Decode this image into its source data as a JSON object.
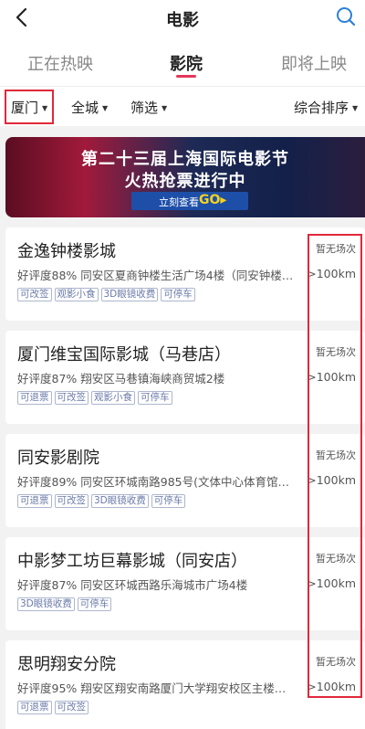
{
  "header": {
    "title": "电影",
    "back_icon": "chevron-left-icon",
    "search_icon": "search-icon"
  },
  "tabs": [
    {
      "label": "正在热映",
      "active": false
    },
    {
      "label": "影院",
      "active": true
    },
    {
      "label": "即将上映",
      "active": false
    }
  ],
  "filters": [
    {
      "label": "厦门",
      "highlighted": true
    },
    {
      "label": "全城"
    },
    {
      "label": "筛选"
    },
    {
      "label": "综合排序"
    }
  ],
  "banner": {
    "line1": "第二十三届上海国际电影节",
    "line2": "火热抢票进行中",
    "button_text": "立刻查看",
    "button_go": "GO▸"
  },
  "cinemas": [
    {
      "name": "金逸钟楼影城",
      "info": "好评度88%  同安区夏商钟楼生活广场4楼（同安钟楼…",
      "tags": [
        "可改签",
        "观影小食",
        "3D眼镜收费",
        "可停车"
      ],
      "status": "暂无场次",
      "distance": ">100km"
    },
    {
      "name": "厦门维宝国际影城（马巷店）",
      "info": "好评度87%  翔安区马巷镇海峡商贸城2楼",
      "tags": [
        "可退票",
        "可改签",
        "观影小食",
        "可停车"
      ],
      "status": "暂无场次",
      "distance": ">100km"
    },
    {
      "name": "同安影剧院",
      "info": "好评度89%  同安区环城南路985号(文体中心体育馆…",
      "tags": [
        "可退票",
        "可改签",
        "3D眼镜收费",
        "可停车"
      ],
      "status": "暂无场次",
      "distance": ">100km"
    },
    {
      "name": "中影梦工坊巨幕影城（同安店）",
      "info": "好评度87%  同安区环城西路乐海城市广场4楼",
      "tags": [
        "3D眼镜收费",
        "可停车"
      ],
      "status": "暂无场次",
      "distance": ">100km"
    },
    {
      "name": "思明翔安分院",
      "info": "好评度95%  翔安区翔安南路厦门大学翔安校区主楼…",
      "tags": [
        "可退票",
        "可改签"
      ],
      "status": "暂无场次",
      "distance": ">100km"
    }
  ],
  "colors": {
    "accent": "#e5365a",
    "highlight_box": "#e0283a",
    "search_icon": "#2b7fd8"
  }
}
